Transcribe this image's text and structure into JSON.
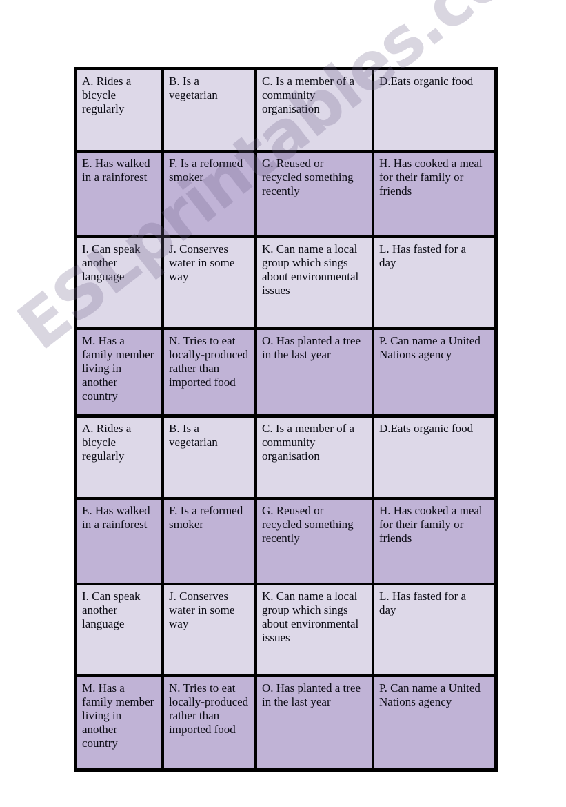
{
  "document": {
    "type": "worksheet-grid",
    "page_background": "#ffffff",
    "watermark_text": "ESLprintables.com"
  },
  "style": {
    "row_light_color": "#ddd8e8",
    "row_dark_color": "#c0b3d6",
    "border_color": "#000000",
    "text_color": "#0b0b14"
  },
  "tables": [
    {
      "id": "bingo-grid-top",
      "rows": [
        {
          "shade": "light",
          "cells": [
            "A. Rides a\nbicycle\nregularly",
            "B. Is a\nvegetarian",
            " C. Is a member of a\ncommunity\norganisation",
            "D.Eats organic food"
          ]
        },
        {
          "shade": "dark",
          "cells": [
            "E. Has walked\nin a rainforest",
            "F. Is a reformed\nsmoker",
            " G. Reused or\nrecycled something\nrecently",
            "H. Has cooked a meal\nfor their family or\nfriends"
          ]
        },
        {
          "shade": "light",
          "cells": [
            "I. Can speak\nanother\nlanguage",
            "J. Conserves\nwater in some\nway",
            " K. Can name a local\ngroup which sings\nabout environmental\nissues",
            "L. Has fasted for a\nday"
          ]
        },
        {
          "shade": "dark",
          "cells": [
            "M. Has a\nfamily member\nliving in\nanother\ncountry",
            " N. Tries to eat\nlocally-produced\nrather than\nimported food",
            "O. Has planted a tree\nin the last year",
            "P. Can name a United\nNations agency"
          ]
        }
      ]
    },
    {
      "id": "bingo-grid-bottom",
      "rows": [
        {
          "shade": "light",
          "cells": [
            "A. Rides a\nbicycle\nregularly",
            "B. Is a\nvegetarian",
            " C. Is a member of a\ncommunity\norganisation",
            "D.Eats organic food"
          ]
        },
        {
          "shade": "dark",
          "cells": [
            "E. Has walked\nin a rainforest",
            "F. Is a reformed\nsmoker",
            " G. Reused or\nrecycled something\nrecently",
            "H. Has cooked a meal\nfor their family or\nfriends"
          ]
        },
        {
          "shade": "light",
          "cells": [
            "I. Can speak\nanother\nlanguage",
            "J. Conserves\nwater in some\nway",
            " K. Can name a local\ngroup which sings\nabout environmental\nissues",
            "L. Has fasted for a\nday"
          ]
        },
        {
          "shade": "dark",
          "cells": [
            "M. Has a\nfamily member\nliving in\nanother\ncountry",
            " N. Tries to eat\nlocally-produced\nrather than\nimported food",
            "O. Has planted a tree\nin the last year",
            "P. Can name a United\nNations agency"
          ]
        }
      ]
    }
  ]
}
